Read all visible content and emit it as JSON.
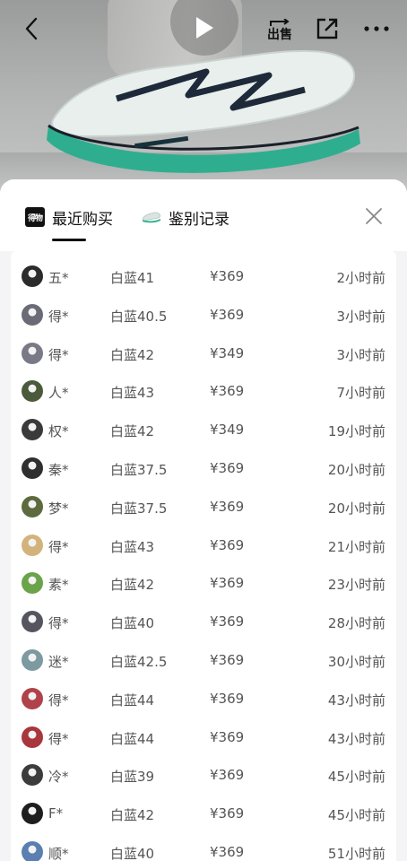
{
  "header": {
    "sell_label": "出售"
  },
  "sheet": {
    "tabs": [
      {
        "label": "最近购买",
        "icon_name": "dewu-logo-icon",
        "logo_text": "得物"
      },
      {
        "label": "鉴别记录",
        "icon_name": "sneaker-icon"
      }
    ]
  },
  "purchases": [
    {
      "name": "五*",
      "spec": "白蓝41",
      "price": "¥369",
      "time": "2小时前",
      "avatar_color": "#2b2b2b"
    },
    {
      "name": "得*",
      "spec": "白蓝40.5",
      "price": "¥369",
      "time": "3小时前",
      "avatar_color": "#6b6b78"
    },
    {
      "name": "得*",
      "spec": "白蓝42",
      "price": "¥349",
      "time": "3小时前",
      "avatar_color": "#7a7a86"
    },
    {
      "name": "人*",
      "spec": "白蓝43",
      "price": "¥369",
      "time": "7小时前",
      "avatar_color": "#4a5a3a"
    },
    {
      "name": "权*",
      "spec": "白蓝42",
      "price": "¥349",
      "time": "19小时前",
      "avatar_color": "#3a3a3a"
    },
    {
      "name": "秦*",
      "spec": "白蓝37.5",
      "price": "¥369",
      "time": "20小时前",
      "avatar_color": "#2f2f2f"
    },
    {
      "name": "梦*",
      "spec": "白蓝37.5",
      "price": "¥369",
      "time": "20小时前",
      "avatar_color": "#5c6a3e"
    },
    {
      "name": "得*",
      "spec": "白蓝43",
      "price": "¥369",
      "time": "21小时前",
      "avatar_color": "#d2b37c"
    },
    {
      "name": "素*",
      "spec": "白蓝42",
      "price": "¥369",
      "time": "23小时前",
      "avatar_color": "#6aa34a"
    },
    {
      "name": "得*",
      "spec": "白蓝40",
      "price": "¥369",
      "time": "28小时前",
      "avatar_color": "#555560"
    },
    {
      "name": "迷*",
      "spec": "白蓝42.5",
      "price": "¥369",
      "time": "30小时前",
      "avatar_color": "#7c9aa0"
    },
    {
      "name": "得*",
      "spec": "白蓝44",
      "price": "¥369",
      "time": "43小时前",
      "avatar_color": "#b0424a"
    },
    {
      "name": "得*",
      "spec": "白蓝44",
      "price": "¥369",
      "time": "43小时前",
      "avatar_color": "#a8363c"
    },
    {
      "name": "冷*",
      "spec": "白蓝39",
      "price": "¥369",
      "time": "45小时前",
      "avatar_color": "#3c3c3c"
    },
    {
      "name": "F*",
      "spec": "白蓝42",
      "price": "¥369",
      "time": "45小时前",
      "avatar_color": "#1e1e1e"
    },
    {
      "name": "顺*",
      "spec": "白蓝40",
      "price": "¥369",
      "time": "51小时前",
      "avatar_color": "#5b7fb0"
    }
  ]
}
